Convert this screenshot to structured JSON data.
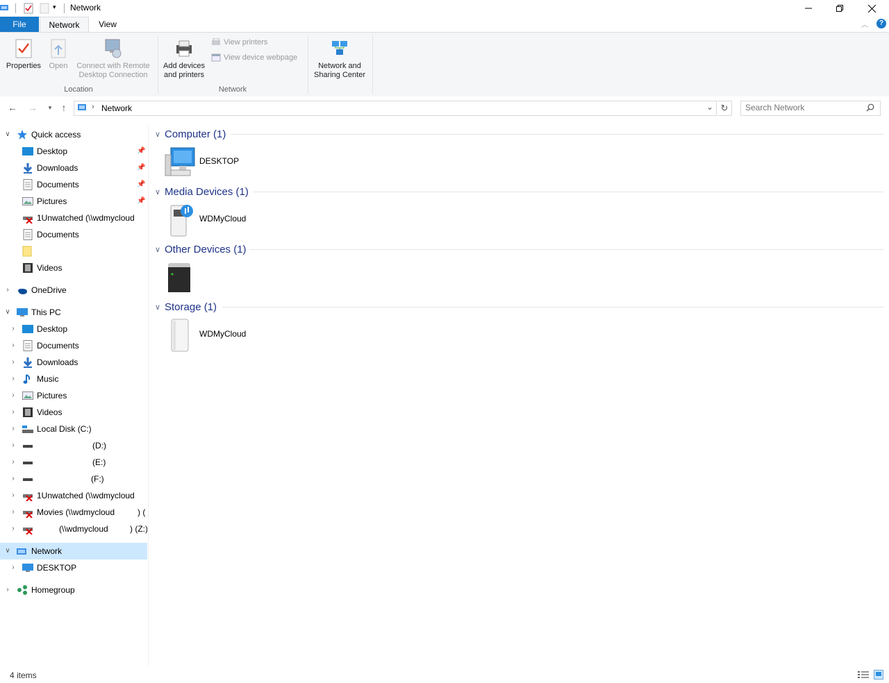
{
  "window": {
    "title": "Network",
    "controls": {
      "minimize": "minimize-icon",
      "maximize": "restore-icon",
      "close": "close-icon"
    }
  },
  "ribbon_tabs": [
    {
      "label": "File"
    },
    {
      "label": "Network"
    },
    {
      "label": "View"
    }
  ],
  "ribbon": {
    "location_group": {
      "label": "Location",
      "buttons": [
        {
          "label_line1": "Properties",
          "label_line2": "",
          "enabled": true
        },
        {
          "label_line1": "Open",
          "label_line2": "",
          "enabled": false
        },
        {
          "label_line1": "Connect with Remote",
          "label_line2": "Desktop Connection",
          "enabled": false
        }
      ]
    },
    "network_group": {
      "label": "Network",
      "add_devices": {
        "label_line1": "Add devices",
        "label_line2": "and printers"
      },
      "view_printers": "View printers",
      "view_device_webpage": "View device webpage"
    },
    "sharing": {
      "label_line1": "Network and",
      "label_line2": "Sharing Center"
    }
  },
  "address_bar": {
    "path": "Network",
    "search_placeholder": "Search Network"
  },
  "nav_pane": {
    "quick_access": {
      "label": "Quick access",
      "items": [
        {
          "label": "Desktop",
          "icon": "desktop-folder-icon",
          "pinned": true
        },
        {
          "label": "Downloads",
          "icon": "downloads-folder-icon",
          "pinned": true
        },
        {
          "label": "Documents",
          "icon": "documents-folder-icon",
          "pinned": true
        },
        {
          "label": "Pictures",
          "icon": "pictures-folder-icon",
          "pinned": true
        },
        {
          "label": "1Unwatched (\\\\wdmycloud",
          "icon": "disconnected-drive-icon",
          "pinned": false
        },
        {
          "label": "Documents",
          "icon": "documents-folder-icon",
          "pinned": false
        },
        {
          "label": "",
          "icon": "folder-icon",
          "pinned": false
        },
        {
          "label": "Videos",
          "icon": "videos-folder-icon",
          "pinned": false
        }
      ]
    },
    "onedrive": {
      "label": "OneDrive"
    },
    "this_pc": {
      "label": "This PC",
      "items": [
        {
          "label": "Desktop",
          "icon": "desktop-folder-icon"
        },
        {
          "label": "Documents",
          "icon": "documents-folder-icon"
        },
        {
          "label": "Downloads",
          "icon": "downloads-folder-icon"
        },
        {
          "label": "Music",
          "icon": "music-folder-icon"
        },
        {
          "label": "Pictures",
          "icon": "pictures-folder-icon"
        },
        {
          "label": "Videos",
          "icon": "videos-folder-icon"
        },
        {
          "label": "Local Disk (C:)",
          "icon": "local-disk-icon"
        },
        {
          "label": "(D:)",
          "icon": "drive-icon"
        },
        {
          "label": "(E:)",
          "icon": "drive-icon"
        },
        {
          "label": "(F:)",
          "icon": "drive-icon"
        },
        {
          "label": "1Unwatched (\\\\wdmycloud",
          "icon": "disconnected-drive-icon"
        },
        {
          "label": "Movies (\\\\wdmycloud",
          "label_suffix": ") (",
          "icon": "disconnected-drive-icon"
        },
        {
          "label": "(\\\\wdmycloud",
          "label_suffix": ") (Z:)",
          "icon": "disconnected-drive-icon"
        }
      ]
    },
    "network": {
      "label": "Network",
      "items": [
        {
          "label": "DESKTOP",
          "icon": "computer-icon"
        }
      ]
    },
    "homegroup": {
      "label": "Homegroup"
    }
  },
  "content": {
    "groups": [
      {
        "header": "Computer (1)",
        "device": "DESKTOP",
        "icon": "computer-icon"
      },
      {
        "header": "Media Devices (1)",
        "device": "WDMyCloud",
        "icon": "media-server-icon"
      },
      {
        "header": "Other Devices (1)",
        "device": "",
        "icon": "server-tower-icon"
      },
      {
        "header": "Storage (1)",
        "device": "WDMyCloud",
        "icon": "nas-storage-icon"
      }
    ]
  },
  "status_bar": {
    "item_count": "4 items"
  },
  "colors": {
    "file_tab": "#1979ca",
    "selection": "#cce8ff",
    "group_header": "#1e3287"
  }
}
